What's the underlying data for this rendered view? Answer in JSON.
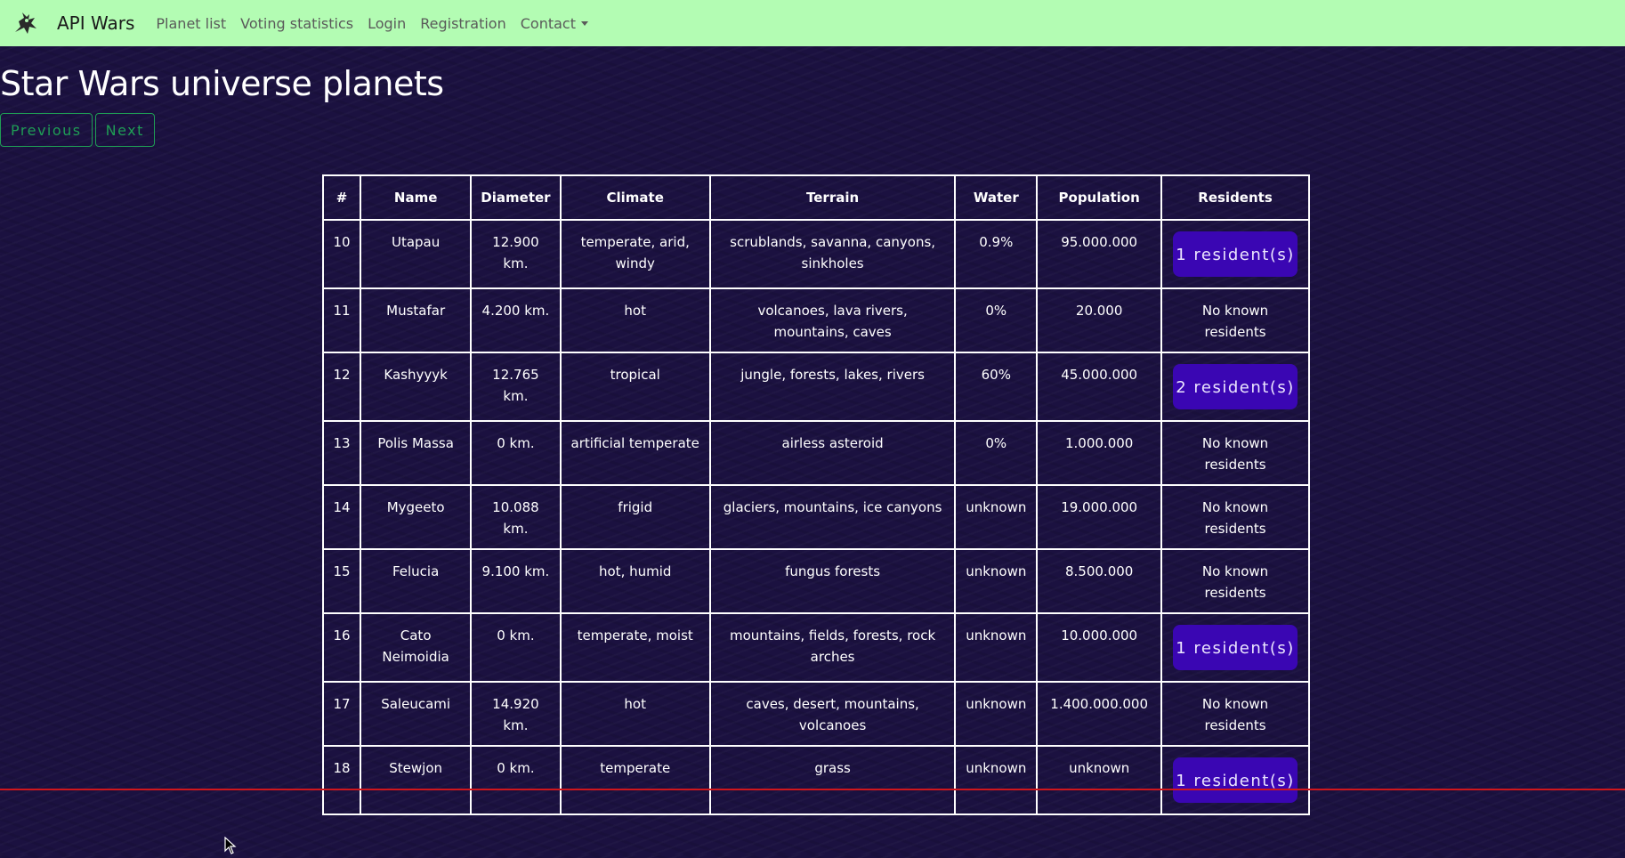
{
  "navbar": {
    "brand": "API Wars",
    "links": [
      "Planet list",
      "Voting statistics",
      "Login",
      "Registration",
      "Contact"
    ]
  },
  "page": {
    "title": "Star Wars universe planets",
    "previous_label": "Previous",
    "next_label": "Next"
  },
  "table": {
    "headers": [
      "#",
      "Name",
      "Diameter",
      "Climate",
      "Terrain",
      "Water",
      "Population",
      "Residents"
    ],
    "rows": [
      {
        "num": "10",
        "name": "Utapau",
        "diameter": "12.900 km.",
        "climate": "temperate, arid, windy",
        "terrain": "scrublands, savanna, canyons, sinkholes",
        "water": "0.9%",
        "population": "95.000.000",
        "residents": "1 resident(s)",
        "has_residents": true
      },
      {
        "num": "11",
        "name": "Mustafar",
        "diameter": "4.200 km.",
        "climate": "hot",
        "terrain": "volcanoes, lava rivers, mountains, caves",
        "water": "0%",
        "population": "20.000",
        "residents": "No known residents",
        "has_residents": false
      },
      {
        "num": "12",
        "name": "Kashyyyk",
        "diameter": "12.765 km.",
        "climate": "tropical",
        "terrain": "jungle, forests, lakes, rivers",
        "water": "60%",
        "population": "45.000.000",
        "residents": "2 resident(s)",
        "has_residents": true
      },
      {
        "num": "13",
        "name": "Polis Massa",
        "diameter": "0 km.",
        "climate": "artificial temperate",
        "terrain": "airless asteroid",
        "water": "0%",
        "population": "1.000.000",
        "residents": "No known residents",
        "has_residents": false
      },
      {
        "num": "14",
        "name": "Mygeeto",
        "diameter": "10.088 km.",
        "climate": "frigid",
        "terrain": "glaciers, mountains, ice canyons",
        "water": "unknown",
        "population": "19.000.000",
        "residents": "No known residents",
        "has_residents": false
      },
      {
        "num": "15",
        "name": "Felucia",
        "diameter": "9.100 km.",
        "climate": "hot, humid",
        "terrain": "fungus forests",
        "water": "unknown",
        "population": "8.500.000",
        "residents": "No known residents",
        "has_residents": false
      },
      {
        "num": "16",
        "name": "Cato Neimoidia",
        "diameter": "0 km.",
        "climate": "temperate, moist",
        "terrain": "mountains, fields, forests, rock arches",
        "water": "unknown",
        "population": "10.000.000",
        "residents": "1 resident(s)",
        "has_residents": true
      },
      {
        "num": "17",
        "name": "Saleucami",
        "diameter": "14.920 km.",
        "climate": "hot",
        "terrain": "caves, desert, mountains, volcanoes",
        "water": "unknown",
        "population": "1.400.000.000",
        "residents": "No known residents",
        "has_residents": false
      },
      {
        "num": "18",
        "name": "Stewjon",
        "diameter": "0 km.",
        "climate": "temperate",
        "terrain": "grass",
        "water": "unknown",
        "population": "unknown",
        "residents": "1 resident(s)",
        "has_residents": true
      }
    ]
  },
  "colors": {
    "navbar_bg": "#b3fcb3",
    "page_bg": "#1b1140",
    "resident_button": "#3a06b3",
    "pager_border": "#1f9d55",
    "marker_line": "#d0161c"
  },
  "icons": {
    "brand": "rebel-rider-logo-icon",
    "dropdown": "caret-down-icon",
    "cursor": "mouse-pointer-icon"
  }
}
